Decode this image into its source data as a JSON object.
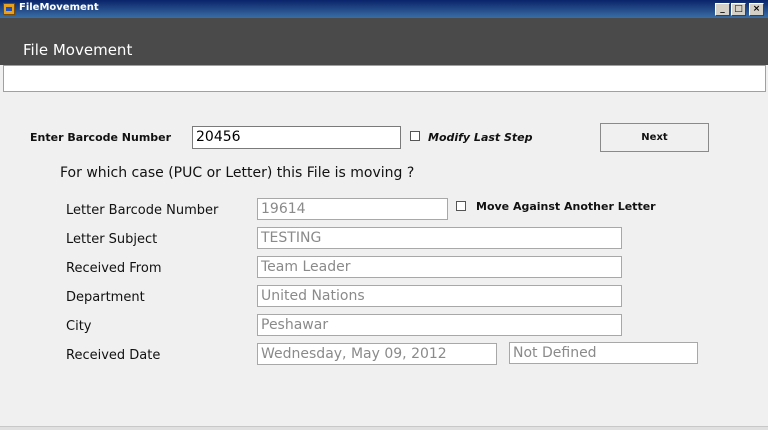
{
  "window": {
    "title": "FileMovement",
    "controls": {
      "minimize": "_",
      "maximize": "□",
      "close": "×"
    }
  },
  "header": {
    "title": "File Movement"
  },
  "barcode": {
    "label": "Enter Barcode Number",
    "value": "20456",
    "modify_label": "Modify Last Step",
    "modify_checked": false
  },
  "next_button": "Next",
  "question": "For which case (PUC or Letter) this File is moving ?",
  "form": {
    "letter_barcode": {
      "label": "Letter Barcode Number",
      "value": "19614"
    },
    "move_against": {
      "label": "Move Against Another Letter",
      "checked": false
    },
    "letter_subject": {
      "label": "Letter Subject",
      "value": "TESTING"
    },
    "received_from": {
      "label": "Received From",
      "value": "Team Leader"
    },
    "department": {
      "label": "Department",
      "value": "United Nations"
    },
    "city": {
      "label": "City",
      "value": "Peshawar"
    },
    "received_date": {
      "label": "Received Date",
      "value": "Wednesday, May 09, 2012",
      "extra": "Not Defined"
    }
  },
  "colors": {
    "header_bg": "#4a4a4a",
    "titlebar": "#0a246a",
    "window_bg": "#f0f0f0"
  }
}
